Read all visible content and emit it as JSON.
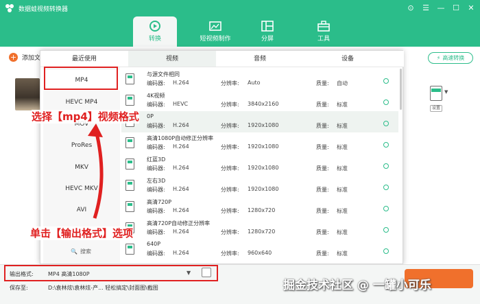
{
  "titlebar": {
    "title": "数据蛙视频转换器",
    "controls": [
      "⊙",
      "☰",
      "—",
      "☐",
      "✕"
    ]
  },
  "nav": [
    {
      "label": "转换",
      "icon": "convert-icon",
      "active": true
    },
    {
      "label": "短视频制作",
      "icon": "video-make-icon",
      "active": false
    },
    {
      "label": "分屏",
      "icon": "split-screen-icon",
      "active": false
    },
    {
      "label": "工具",
      "icon": "toolbox-icon",
      "active": false
    }
  ],
  "toolbar": {
    "add_file_label": "添加文",
    "speed_label": "高速转换"
  },
  "settings_label": "设置",
  "format_panel": {
    "tabs": [
      "最近使用",
      "视频",
      "音频",
      "设备"
    ],
    "categories": [
      "MP4",
      "HEVC MP4",
      "MOV",
      "ProRes",
      "MKV",
      "HEVC MKV",
      "AVI"
    ],
    "search_label": "搜索",
    "field_labels": {
      "encoder": "编码器:",
      "resolution": "分辨率:",
      "quality": "质量:"
    },
    "rows": [
      {
        "name": "与源文件相同",
        "encoder": "H.264",
        "resolution": "Auto",
        "quality": "自动"
      },
      {
        "name": "4K视频",
        "encoder": "HEVC",
        "resolution": "3840x2160",
        "quality": "标准"
      },
      {
        "name": "0P",
        "encoder": "H.264",
        "resolution": "1920x1080",
        "quality": "标准"
      },
      {
        "name": "高清1080P自动修正分辨率",
        "encoder": "H.264",
        "resolution": "1920x1080",
        "quality": "标准"
      },
      {
        "name": "红蓝3D",
        "encoder": "H.264",
        "resolution": "1920x1080",
        "quality": "标准"
      },
      {
        "name": "左右3D",
        "encoder": "H.264",
        "resolution": "1920x1080",
        "quality": "标准"
      },
      {
        "name": "高清720P",
        "encoder": "H.264",
        "resolution": "1280x720",
        "quality": "标准"
      },
      {
        "name": "高清720P自动修正分辨率",
        "encoder": "H.264",
        "resolution": "1280x720",
        "quality": "标准"
      },
      {
        "name": "640P",
        "encoder": "H.264",
        "resolution": "960x640",
        "quality": "标准"
      }
    ]
  },
  "annotations": {
    "select_mp4": "选择【mp4】视频格式",
    "click_output": "单击【输出格式】选项"
  },
  "bottom": {
    "output_format_label": "输出格式:",
    "output_format_value": "MP4 高清1080P",
    "save_to_label": "保存至:",
    "save_to_value": "D:\\袁林炫\\袁林炫-产... 轻松搞定\\封面图\\截图"
  },
  "watermark": "掘金技术社区 @ 一罐小可乐",
  "colors": {
    "brand": "#2bbd8a",
    "accent": "#f0702c",
    "annotation": "#e02020"
  }
}
